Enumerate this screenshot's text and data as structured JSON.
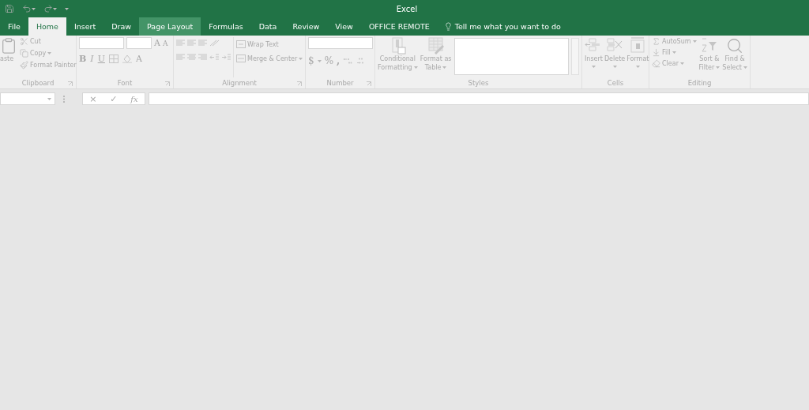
{
  "title": "Excel",
  "tabs": [
    {
      "label": "File",
      "selected": false,
      "hovered": false
    },
    {
      "label": "Home",
      "selected": true,
      "hovered": false
    },
    {
      "label": "Insert",
      "selected": false,
      "hovered": false
    },
    {
      "label": "Draw",
      "selected": false,
      "hovered": false
    },
    {
      "label": "Page Layout",
      "selected": false,
      "hovered": true
    },
    {
      "label": "Formulas",
      "selected": false,
      "hovered": false
    },
    {
      "label": "Data",
      "selected": false,
      "hovered": false
    },
    {
      "label": "Review",
      "selected": false,
      "hovered": false
    },
    {
      "label": "View",
      "selected": false,
      "hovered": false
    },
    {
      "label": "OFFICE REMOTE",
      "selected": false,
      "hovered": false
    }
  ],
  "tell_me": "Tell me what you want to do",
  "ribbon": {
    "disabled": true,
    "clipboard": {
      "label": "Clipboard",
      "paste": "aste",
      "cut": "Cut",
      "copy": "Copy",
      "format_painter": "Format Painter"
    },
    "font": {
      "label": "Font",
      "grow": "A",
      "shrink": "A",
      "bold": "B",
      "italic": "I",
      "underline": "U",
      "font_color": "A"
    },
    "alignment": {
      "label": "Alignment",
      "wrap": "Wrap Text",
      "merge": "Merge & Center"
    },
    "number": {
      "label": "Number",
      "currency": "$",
      "percent": "%",
      "comma": ","
    },
    "styles": {
      "label": "Styles",
      "conditional": [
        "Conditional",
        "Formatting"
      ],
      "format_table": [
        "Format as",
        "Table"
      ]
    },
    "cells": {
      "label": "Cells",
      "insert": "Insert",
      "delete": "Delete",
      "format": "Format"
    },
    "editing": {
      "label": "Editing",
      "autosum": "AutoSum",
      "fill": "Fill",
      "clear": "Clear",
      "sort": [
        "Sort &",
        "Filter"
      ],
      "find": [
        "Find &",
        "Select"
      ]
    }
  },
  "formula_bar": {
    "cancel": "×",
    "enter": "✓",
    "function": "fx"
  }
}
